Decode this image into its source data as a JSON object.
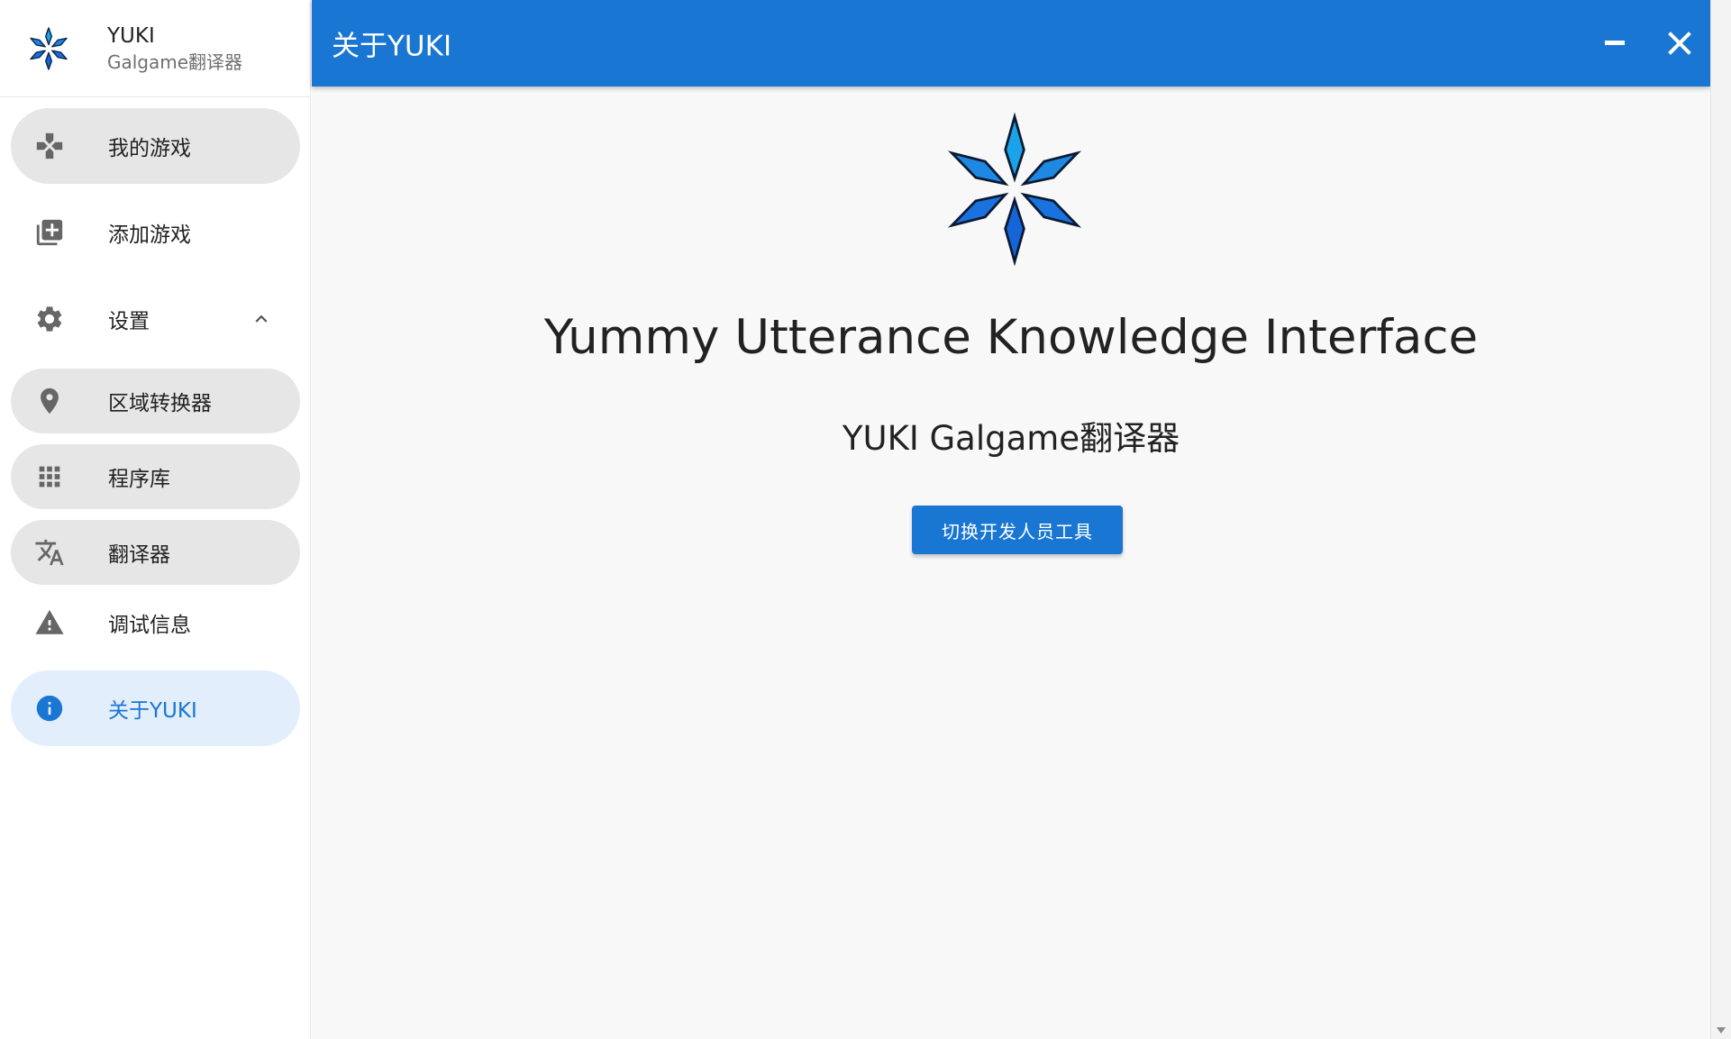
{
  "brand": {
    "title": "YUKI",
    "subtitle": "Galgame翻译器",
    "icon": "yuki-snowflake-logo"
  },
  "sidebar": {
    "items": [
      {
        "label": "我的游戏",
        "icon": "gamepad-icon",
        "state": "hover"
      },
      {
        "label": "添加游戏",
        "icon": "library-add-icon",
        "state": "normal"
      },
      {
        "label": "设置",
        "icon": "gear-icon",
        "state": "expanded",
        "chevron": "chevron-up-icon"
      },
      {
        "label": "区域转换器",
        "icon": "map-pin-icon",
        "state": "hover"
      },
      {
        "label": "程序库",
        "icon": "apps-grid-icon",
        "state": "hover"
      },
      {
        "label": "翻译器",
        "icon": "translate-icon",
        "state": "hover"
      },
      {
        "label": "调试信息",
        "icon": "warning-icon",
        "state": "normal"
      },
      {
        "label": "关于YUKI",
        "icon": "info-icon",
        "state": "active"
      }
    ]
  },
  "titlebar": {
    "title": "关于YUKI",
    "minimize_icon": "minimize-icon",
    "close_icon": "close-icon"
  },
  "about": {
    "headline": "Yummy Utterance Knowledge Interface",
    "subline": "YUKI Galgame翻译器",
    "button_label": "切换开发人员工具"
  },
  "colors": {
    "primary": "#1976d2",
    "active_bg": "#e3eefc",
    "hover_bg": "#e6e6e6",
    "icon_grey": "#666666",
    "logo_light": "#1aa3e8",
    "logo_dark": "#1565d8"
  }
}
